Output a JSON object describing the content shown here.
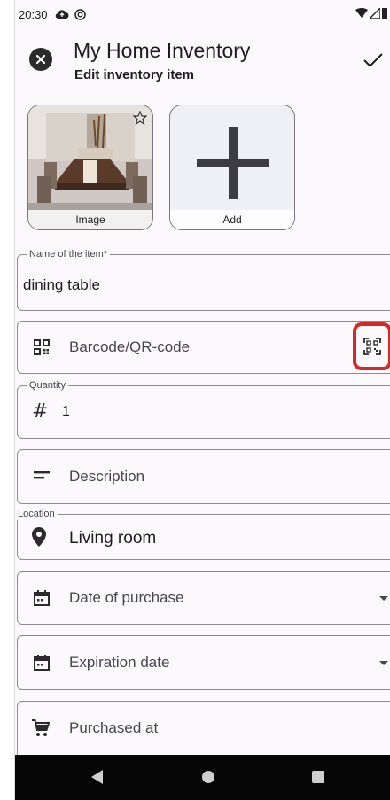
{
  "status_bar": {
    "time": "20:30",
    "icons": [
      "cloud-icon",
      "vpn-icon",
      "wifi-icon",
      "signal-icon",
      "battery-icon"
    ]
  },
  "app_bar": {
    "title": "My Home Inventory",
    "subtitle": "Edit inventory item",
    "close_icon": "close-icon",
    "done_icon": "check-icon"
  },
  "images": {
    "photo_label": "Image",
    "add_label": "Add"
  },
  "form": {
    "name": {
      "label": "Name of the item*",
      "value": "dining table"
    },
    "barcode": {
      "placeholder": "Barcode/QR-code",
      "icon": "qr-code-icon",
      "scan_icon": "qr-scan-icon"
    },
    "quantity": {
      "label": "Quantity",
      "value": "1",
      "icon": "hash-icon"
    },
    "description": {
      "placeholder": "Description",
      "icon": "notes-icon"
    },
    "location": {
      "label": "Location",
      "value": "Living room",
      "icon": "location-pin-icon"
    },
    "date_of_purchase": {
      "placeholder": "Date of purchase",
      "icon": "calendar-icon"
    },
    "expiration_date": {
      "placeholder": "Expiration date",
      "icon": "calendar-icon"
    },
    "purchased_at": {
      "placeholder": "Purchased at",
      "icon": "cart-icon"
    }
  },
  "colors": {
    "scan_highlight": "#d12a2a",
    "background": "#fbf9fc",
    "nav_bar": "#060606"
  }
}
